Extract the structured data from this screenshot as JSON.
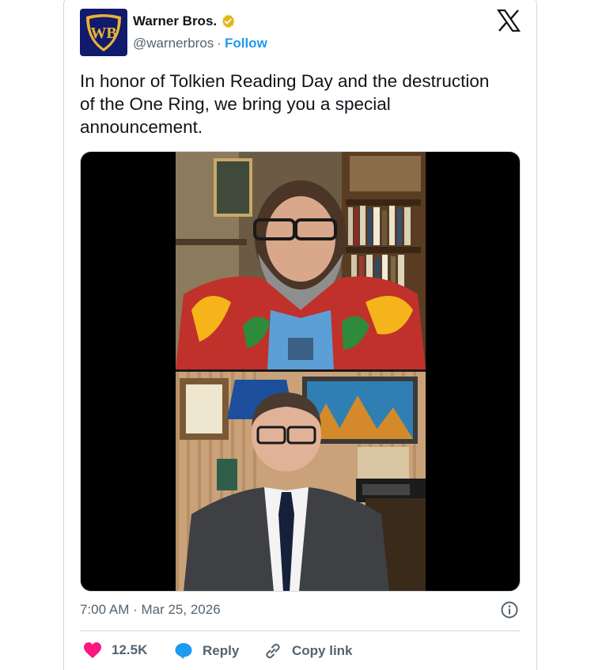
{
  "account": {
    "display_name": "Warner Bros.",
    "handle": "@warnerbros",
    "separator": "·",
    "follow_label": "Follow",
    "avatar_text": "WB",
    "verified_icon": "verified-badge-icon"
  },
  "tweet": {
    "text": "In honor of Tolkien Reading Day and the destruction of the One Ring, we bring you a special announcement."
  },
  "meta": {
    "timestamp": "7:00 AM · Mar 25, 2026"
  },
  "actions": {
    "likes_count": "12.5K",
    "reply_label": "Reply",
    "copy_link_label": "Copy link"
  },
  "colors": {
    "like": "#f91880",
    "reply": "#1d9bf0",
    "link": "#1d9bf0",
    "verified": "#e2b719",
    "avatar_bg": "#111a6d"
  }
}
